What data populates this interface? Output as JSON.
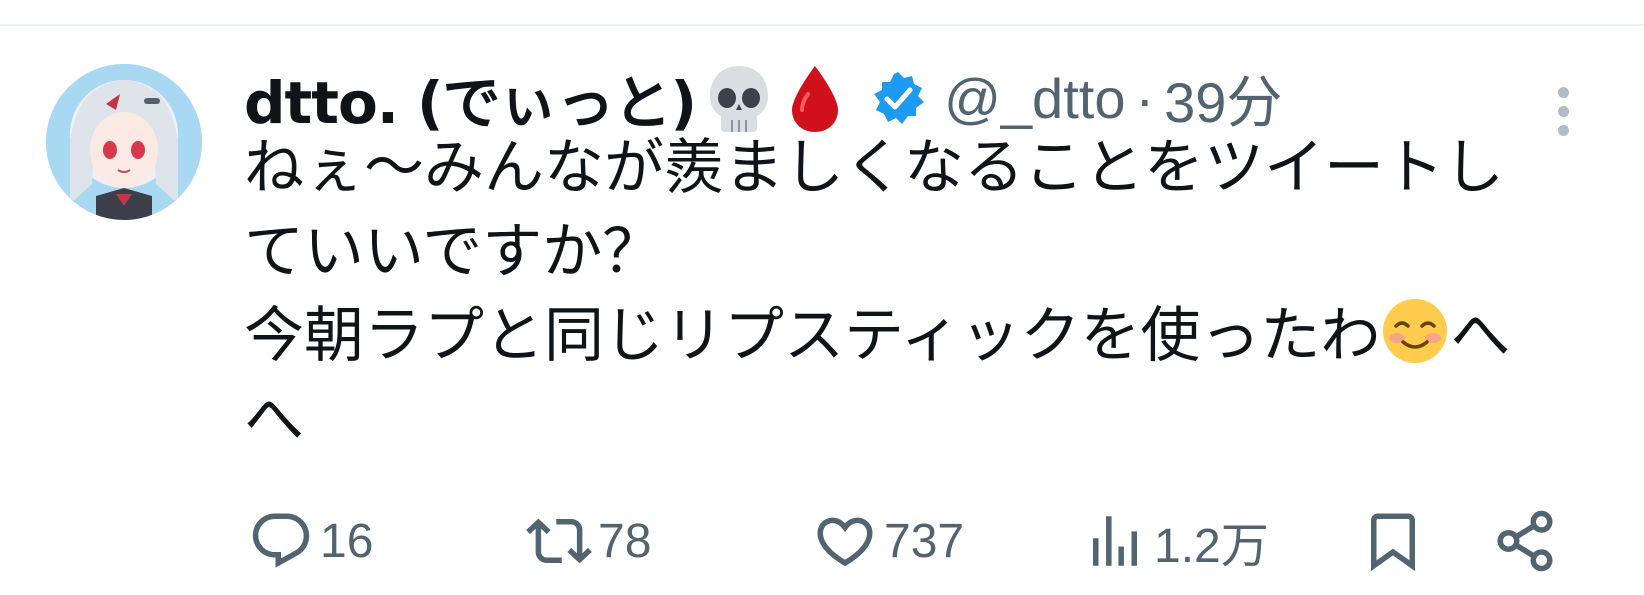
{
  "tweet": {
    "author": {
      "display_name": "dtto. (でぃっと)",
      "name_emojis": [
        "skull-emoji",
        "blood-drop-emoji"
      ],
      "verified": true,
      "handle": "@_dtto",
      "separator": "·",
      "timestamp": "39分"
    },
    "text_lines": [
      "ねぇ〜みんなが羨ましくなることをツイートし",
      "ていいですか？",
      "今朝ラプと同じリプスティックを使ったわ",
      "へ"
    ],
    "text_line3_suffix": "へ",
    "text_inline_emoji": "smiling-face-emoji",
    "actions": {
      "reply_count": "16",
      "retweet_count": "78",
      "like_count": "737",
      "views_count": "1.2万"
    },
    "colors": {
      "text": "#0f1419",
      "secondary": "#536471",
      "verified": "#1d9bf0",
      "divider": "#eff3f4"
    }
  }
}
